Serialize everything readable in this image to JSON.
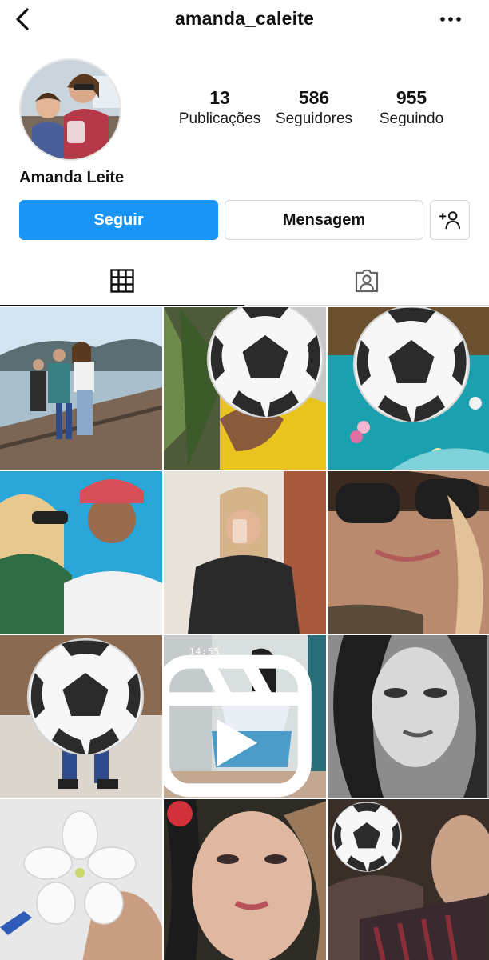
{
  "header": {
    "username": "amanda_caleite",
    "back_icon": "chevron-left-icon",
    "more_icon": "more-horizontal-icon"
  },
  "profile": {
    "full_name": "Amanda Leite",
    "stats": {
      "posts": {
        "value": "13",
        "label": "Publicações"
      },
      "followers": {
        "value": "586",
        "label": "Seguidores"
      },
      "following": {
        "value": "955",
        "label": "Seguindo"
      }
    }
  },
  "actions": {
    "follow_label": "Seguir",
    "message_label": "Mensagem",
    "suggest_icon": "add-user-icon"
  },
  "tabs": [
    {
      "name": "grid",
      "icon": "grid-icon",
      "active": true
    },
    {
      "name": "tagged",
      "icon": "tagged-person-icon",
      "active": false
    }
  ],
  "grid": {
    "posts_visible": 12,
    "reel_time_label": "14:55"
  },
  "colors": {
    "follow_button": "#1b95f5",
    "text": "#111111",
    "border": "#d7d7d7"
  }
}
